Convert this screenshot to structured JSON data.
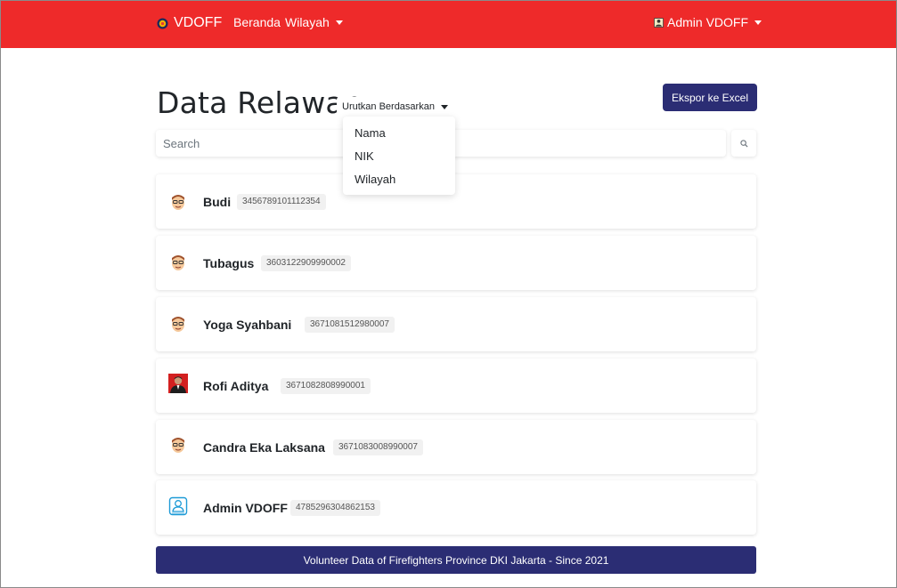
{
  "navbar": {
    "brand": "VDOFF",
    "links": [
      "Beranda",
      "Wilayah"
    ],
    "user": "Admin VDOFF",
    "bg_color": "#ee2a2a"
  },
  "page": {
    "title": "Data Relawan",
    "sort_label": "Urutkan Berdasarkan",
    "sort_options": [
      "Nama",
      "NIK",
      "Wilayah"
    ],
    "export_label": "Ekspor ke Excel",
    "search_placeholder": "Search"
  },
  "volunteers": [
    {
      "name": "Budi",
      "nik": "3456789101112354",
      "avatar": "cartoon-face-icon"
    },
    {
      "name": "Tubagus",
      "nik": "3603122909990002",
      "avatar": "cartoon-face-icon"
    },
    {
      "name": "Yoga Syahbani",
      "nik": "3671081512980007",
      "avatar": "cartoon-face-icon"
    },
    {
      "name": "Rofi Aditya",
      "nik": "3671082808990001",
      "avatar": "photo-avatar"
    },
    {
      "name": "Candra Eka Laksana",
      "nik": "3671083008990007",
      "avatar": "cartoon-face-icon"
    },
    {
      "name": "Admin VDOFF",
      "nik": "4785296304862153",
      "avatar": "user-outline-icon"
    }
  ],
  "footer": {
    "text": "Volunteer Data of Firefighters Province DKI Jakarta - Since 2021",
    "bg_color": "#2b2d74"
  }
}
